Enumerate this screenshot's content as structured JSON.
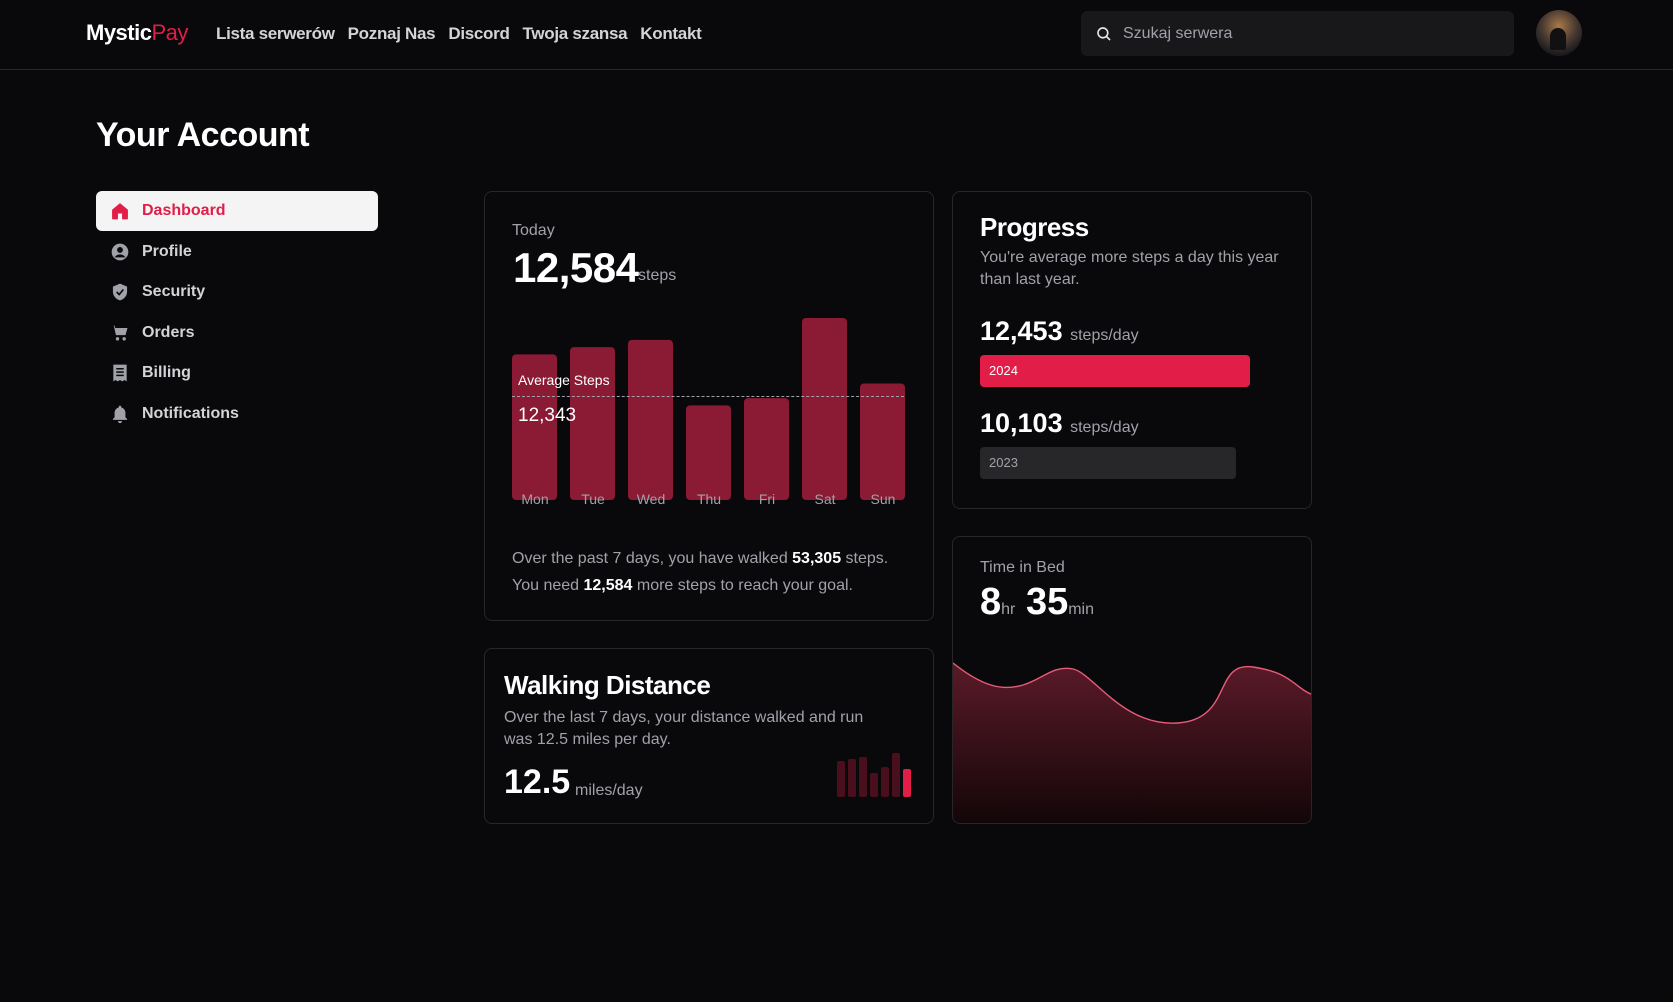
{
  "brand": {
    "part1": "Mystic",
    "part2": "Pay"
  },
  "nav": [
    "Lista serwerów",
    "Poznaj Nas",
    "Discord",
    "Twoja szansa",
    "Kontakt"
  ],
  "search": {
    "placeholder": "Szukaj serwera"
  },
  "page": {
    "title": "Your Account"
  },
  "sidebar": {
    "items": [
      {
        "label": "Dashboard",
        "icon": "home-icon",
        "active": true
      },
      {
        "label": "Profile",
        "icon": "user-circle-icon"
      },
      {
        "label": "Security",
        "icon": "shield-icon"
      },
      {
        "label": "Orders",
        "icon": "cart-icon"
      },
      {
        "label": "Billing",
        "icon": "receipt-icon"
      },
      {
        "label": "Notifications",
        "icon": "bell-icon"
      }
    ]
  },
  "steps_card": {
    "label": "Today",
    "value": "12,584",
    "unit": "steps",
    "avg_label": "Average Steps",
    "avg_value": "12,343",
    "summary_1a": "Over the past 7 days, you have walked ",
    "summary_1b": "53,305",
    "summary_1c": " steps.",
    "summary_2a": "You need ",
    "summary_2b": "12,584",
    "summary_2c": " more steps to reach your goal."
  },
  "chart_data": {
    "type": "bar",
    "categories": [
      "Mon",
      "Tue",
      "Wed",
      "Thu",
      "Fri",
      "Sat",
      "Sun"
    ],
    "values": [
      12000,
      12600,
      13200,
      7800,
      8400,
      15000,
      9600
    ],
    "average": 12343,
    "ylim": [
      0,
      15000
    ],
    "bar_color": "#8b1a34"
  },
  "progress_card": {
    "title": "Progress",
    "desc": "You're average more steps a day this year than last year.",
    "rows": [
      {
        "value": "12,453",
        "unit": "steps/day",
        "label": "2024"
      },
      {
        "value": "10,103",
        "unit": "steps/day",
        "label": "2023"
      }
    ]
  },
  "walk_card": {
    "title": "Walking Distance",
    "desc": "Over the last 7 days, your distance walked and run was 12.5 miles per day.",
    "value": "12.5",
    "unit": "miles/day"
  },
  "bed_card": {
    "label": "Time in Bed",
    "hours": "8",
    "hr_unit": "hr",
    "minutes": "35",
    "min_unit": "min"
  },
  "colors": {
    "accent": "#e11d48",
    "bar": "#8b1a34",
    "bg": "#09090b"
  }
}
